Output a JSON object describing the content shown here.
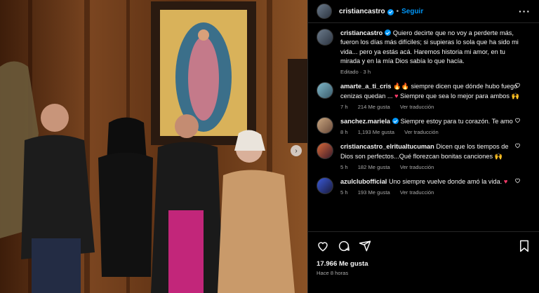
{
  "header": {
    "username": "cristiancastro",
    "dot": "•",
    "follow_label": "Seguir",
    "more_icon": "more-horizontal-icon"
  },
  "caption": {
    "username": "cristiancastro",
    "text": "Quiero decirte que no voy a perderte más, fueron los días más difíciles; si supieras lo sola que ha sido mi vida... pero ya estás acá. Haremos historia mi amor, en tu mirada y en la mía Dios sabía lo que hacía.",
    "meta": "Editado · 3 h"
  },
  "comments": [
    {
      "username": "amarte_a_ti_cris",
      "pre_emoji": "🔥🔥",
      "text": " siempre dicen que dónde hubo fuego cenizas quedan ...",
      "mid_emoji": "♥",
      "text2": " Siempre que sea lo mejor para ambos ",
      "end_emoji": "🙌",
      "time": "7 h",
      "likes": "214 Me gusta",
      "reply": "Ver traducción"
    },
    {
      "username": "sanchez.mariela",
      "verified": true,
      "text": "Siempre estoy para tu corazón. Te amo",
      "time": "8 h",
      "likes": "1,193 Me gusta",
      "reply": "Ver traducción"
    },
    {
      "username": "cristiancastro_elritualtucuman",
      "text": "Dicen que los tiempos de Dios son perfectos...Qué florezcan bonitas canciones ",
      "end_emoji": "🙌",
      "time": "5 h",
      "likes": "182 Me gusta",
      "reply": "Ver traducción"
    },
    {
      "username": "azulclubofficial",
      "text": "Uno siempre vuelve donde amó la vida. ",
      "end_emoji": "♥",
      "time": "5 h",
      "likes": "193 Me gusta",
      "reply": "Ver traducción"
    }
  ],
  "footer": {
    "likes": "17.966 Me gusta",
    "time": "Hace 8 horas"
  },
  "colors": {
    "accent": "#0095f6",
    "muted": "#a8a8a8",
    "bg": "#000000",
    "heart": "#ff3b6b"
  }
}
